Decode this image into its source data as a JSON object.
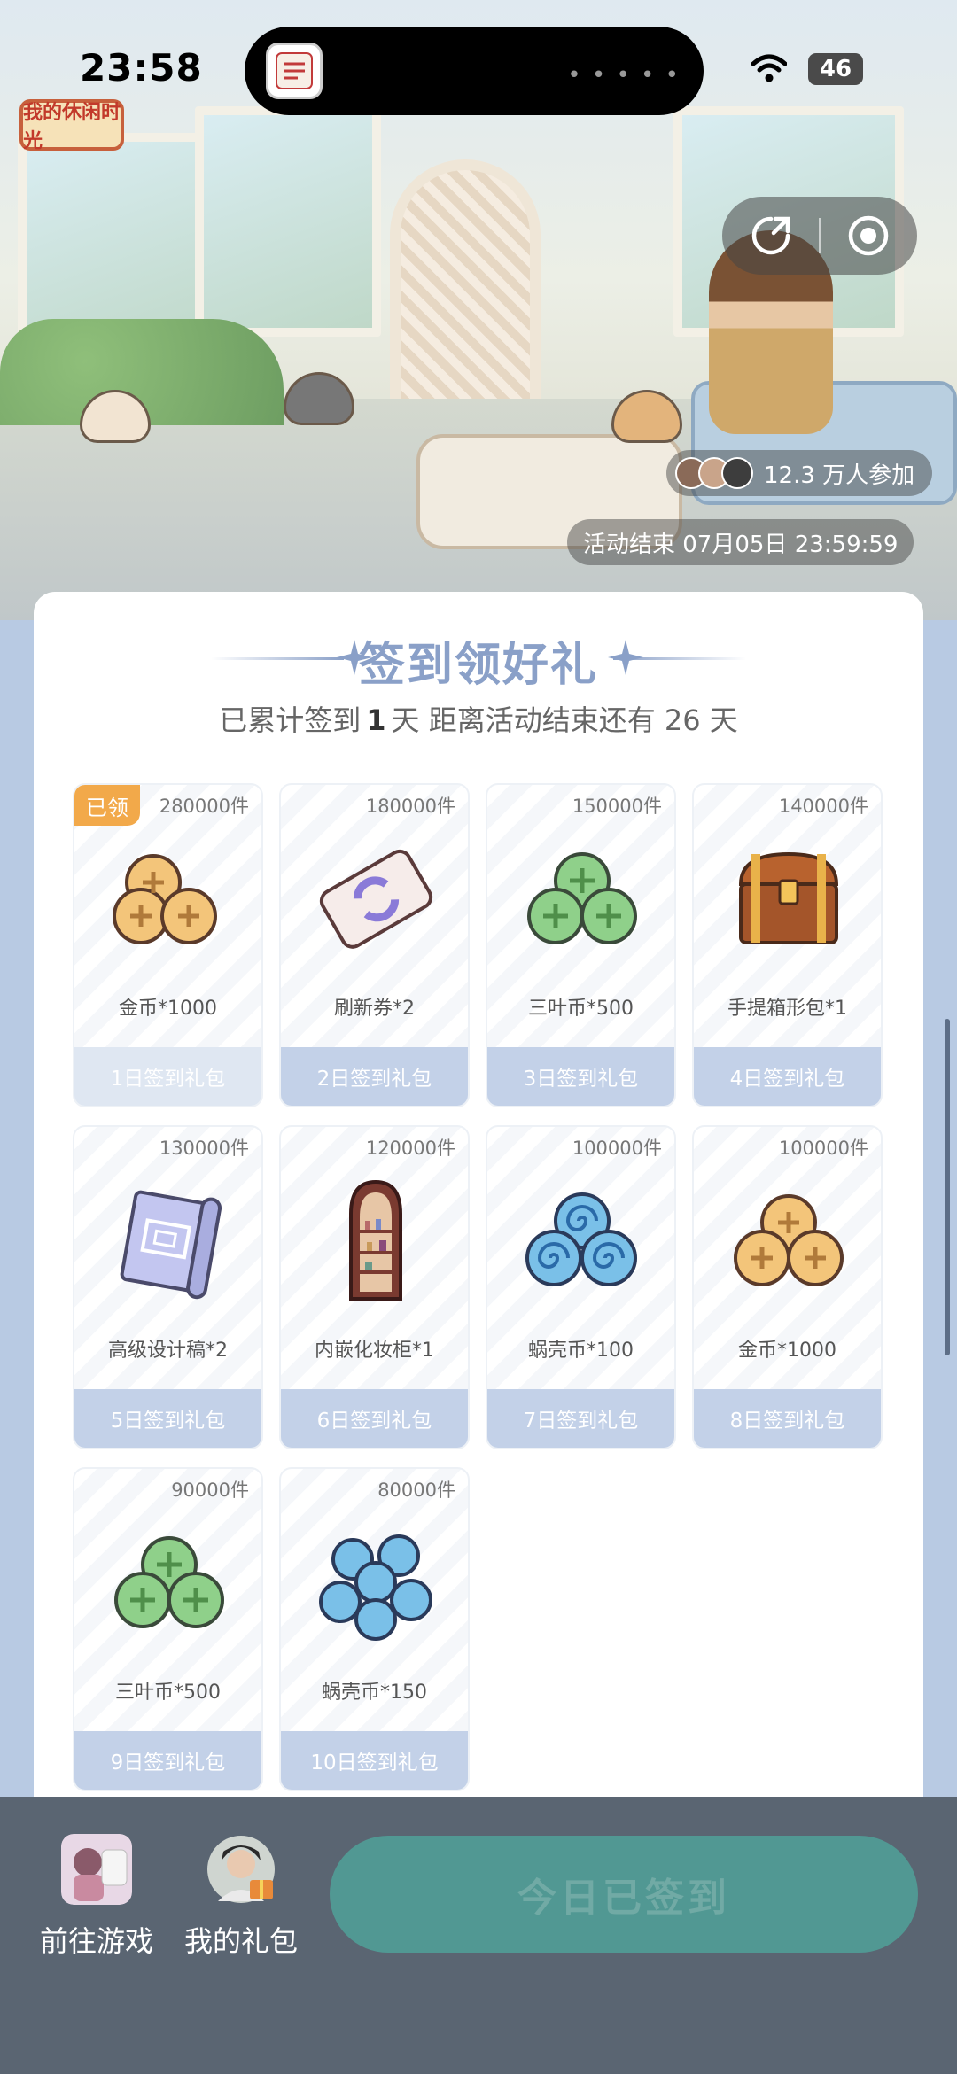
{
  "status_bar": {
    "time": "23:58",
    "battery": "46"
  },
  "banner": {
    "logo_text": "我的休闲时光",
    "participants": "12.3 万人参加",
    "end_time": "活动结束 07月05日 23:59:59"
  },
  "header": {
    "title": "签到领好礼",
    "subtitle_prefix": "已累计签到",
    "signed_days": "1",
    "subtitle_mid": "天  距离活动结束还有 26 天"
  },
  "rewards": [
    {
      "qty": "280000件",
      "item": "金币*1000",
      "day": "1日签到礼包",
      "claimed": "已领",
      "icon": "gold-coins-icon"
    },
    {
      "qty": "180000件",
      "item": "刷新券*2",
      "day": "2日签到礼包",
      "icon": "refresh-ticket-icon"
    },
    {
      "qty": "150000件",
      "item": "三叶币*500",
      "day": "3日签到礼包",
      "icon": "clover-coins-icon"
    },
    {
      "qty": "140000件",
      "item": "手提箱形包*1",
      "day": "4日签到礼包",
      "icon": "treasure-chest-icon"
    },
    {
      "qty": "130000件",
      "item": "高级设计稿*2",
      "day": "5日签到礼包",
      "icon": "blueprint-scroll-icon"
    },
    {
      "qty": "120000件",
      "item": "内嵌化妆柜*1",
      "day": "6日签到礼包",
      "icon": "vanity-cabinet-icon"
    },
    {
      "qty": "100000件",
      "item": "蜗壳币*100",
      "day": "7日签到礼包",
      "icon": "snail-coins-icon"
    },
    {
      "qty": "100000件",
      "item": "金币*1000",
      "day": "8日签到礼包",
      "icon": "gold-coins-icon"
    },
    {
      "qty": "90000件",
      "item": "三叶币*500",
      "day": "9日签到礼包",
      "icon": "clover-coins-icon"
    },
    {
      "qty": "80000件",
      "item": "蜗壳币*150",
      "day": "10日签到礼包",
      "icon": "snail-coins-icon"
    }
  ],
  "bottom_bar": {
    "go_game": "前往游戏",
    "my_gifts": "我的礼包",
    "sign_button": "今日已签到"
  },
  "colors": {
    "accent": "#519893",
    "title": "#8aa0c8",
    "claimed_badge": "#f2a94a",
    "day_bar": "#c3d1e8",
    "bottom_bar": "#5a6572"
  }
}
